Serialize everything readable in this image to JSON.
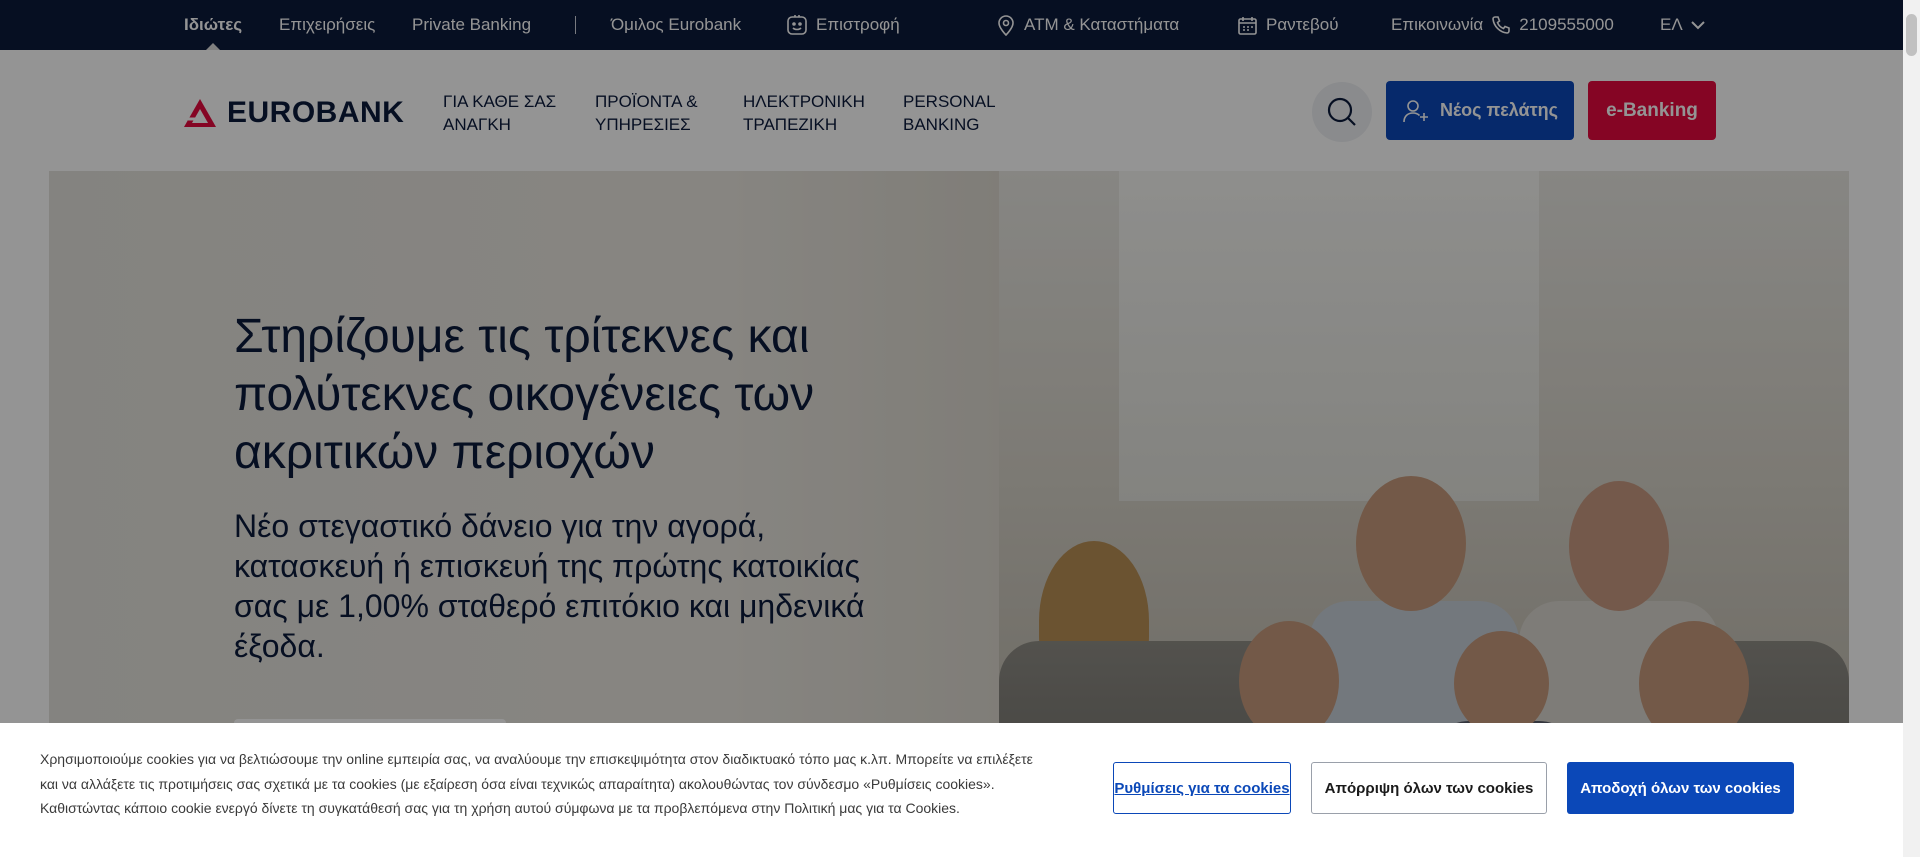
{
  "topbar": {
    "segments": [
      "Ιδιώτες",
      "Επιχειρήσεις",
      "Private Banking"
    ],
    "group": "Όμιλος Eurobank",
    "returns": "Επιστροφή",
    "atm": "ATM & Καταστήματα",
    "appointment": "Ραντεβού",
    "contact": "Επικοινωνία",
    "phone": "2109555000",
    "language": "ΕΛ"
  },
  "header": {
    "logo": "EUROBANK",
    "nav": [
      {
        "line1": "ΓΙΑ ΚΑΘΕ ΣΑΣ",
        "line2": "ΑΝΑΓΚΗ"
      },
      {
        "line1": "ΠΡΟΪΟΝΤΑ &",
        "line2": "ΥΠΗΡΕΣΙΕΣ"
      },
      {
        "line1": "ΗΛΕΚΤΡΟΝΙΚΗ",
        "line2": "ΤΡΑΠΕΖΙΚΗ"
      },
      {
        "line1": "PERSONAL",
        "line2": "BANKING"
      }
    ],
    "new_client": "Νέος πελάτης",
    "ebanking": "e-Banking"
  },
  "hero": {
    "title": "Στηρίζουμε τις τρίτεκνες και πολύτεκνες οικογένειες των ακριτικών περιοχών",
    "subtitle": "Νέο στεγαστικό δάνειο για την αγορά, κατασκευή ή επισκευή της πρώτης κατοικίας σας με 1,00% σταθερό επιτόκιο και μηδενικά έξοδα."
  },
  "cookie": {
    "text": "Χρησιμοποιούμε cookies για να βελτιώσουμε την online εμπειρία σας, να αναλύουμε την επισκεψιμότητα στον διαδικτυακό τόπο μας κ.λπ. Μπορείτε να επιλέξετε και να αλλάξετε τις προτιμήσεις σας σχετικά με τα cookies (με εξαίρεση όσα είναι τεχνικώς απαραίτητα) ακολουθώντας τον σύνδεσμο «Ρυθμίσεις cookies». Καθιστώντας κάποιο cookie ενεργό δίνετε τη συγκατάθεσή σας για τη χρήση αυτού σύμφωνα με τα προβλεπόμενα στην Πολιτική μας για τα Cookies.",
    "settings": "Ρυθμίσεις για τα cookies",
    "reject": "Απόρριψη όλων των cookies",
    "accept": "Αποδοχή όλων των cookies"
  },
  "colors": {
    "navy": "#0c1a3c",
    "blue": "#0b48b8",
    "red": "#e5093f"
  },
  "icons": {
    "returns": "smile-icon",
    "atm": "map-pin-icon",
    "appointment": "calendar-icon",
    "contact": "phone-icon",
    "language": "chevron-down-icon",
    "search": "search-icon",
    "new_client": "add-user-icon"
  }
}
